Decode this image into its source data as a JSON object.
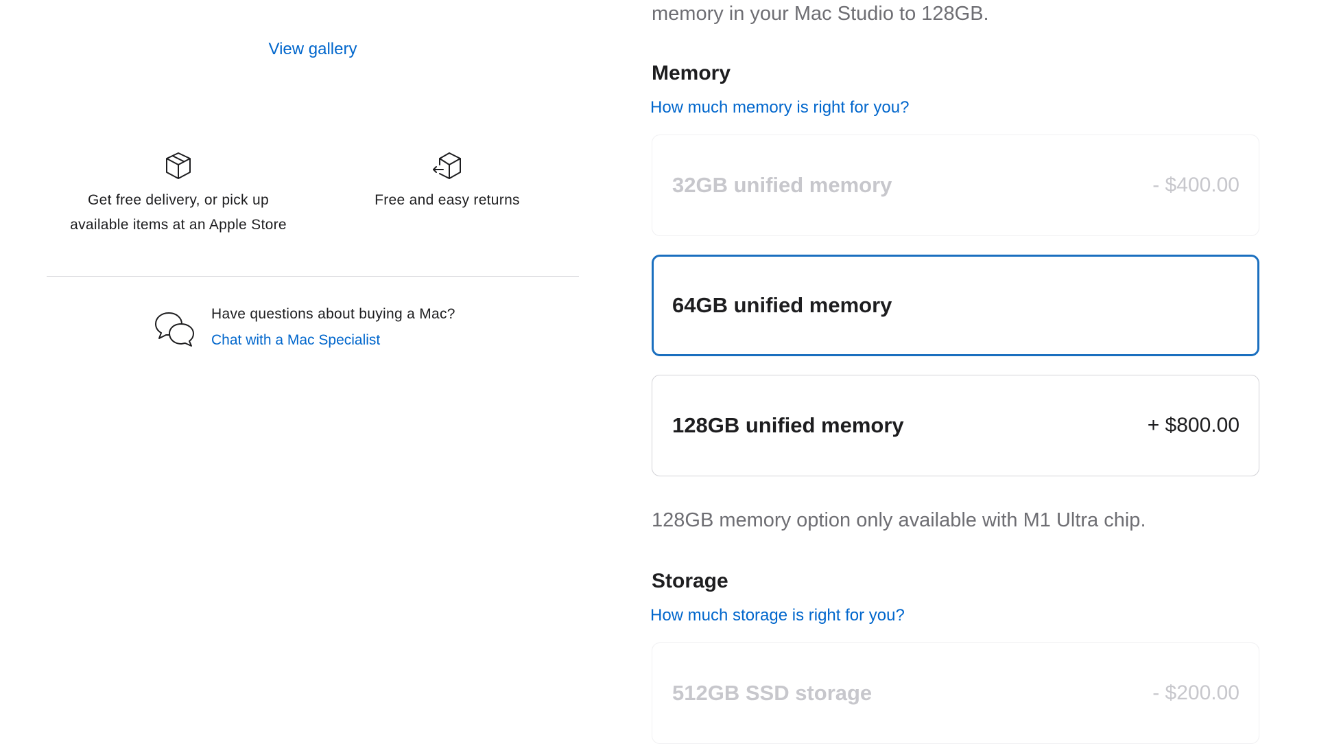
{
  "left": {
    "gallery_link": "View gallery",
    "features": [
      {
        "icon": "box-icon",
        "text_line1": "Get free delivery, or pick up",
        "text_line2": "available items at an Apple Store"
      },
      {
        "icon": "box-return-icon",
        "text_line1": "Free and easy returns"
      }
    ],
    "chat": {
      "icon": "chat-bubbles-icon",
      "question": "Have questions about buying a Mac?",
      "link": "Chat with a Mac Specialist"
    }
  },
  "right": {
    "intro_text": "memory in your Mac Studio to 128GB.",
    "memory": {
      "heading": "Memory",
      "help_link": "How much memory is right for you?",
      "options": [
        {
          "label": "32GB unified memory",
          "price": "- $400.00",
          "state": "disabled"
        },
        {
          "label": "64GB unified memory",
          "price": "",
          "state": "selected"
        },
        {
          "label": "128GB unified memory",
          "price": "+ $800.00",
          "state": "available"
        }
      ],
      "note": "128GB memory option only available with M1 Ultra chip."
    },
    "storage": {
      "heading": "Storage",
      "help_link": "How much storage is right for you?",
      "options": [
        {
          "label": "512GB SSD storage",
          "price": "- $200.00",
          "state": "disabled"
        }
      ]
    }
  },
  "colors": {
    "link": "#0066cc",
    "selected_border": "#1a6fbf",
    "disabled_text": "#c7c7cc",
    "secondary_text": "#6e6e73"
  }
}
